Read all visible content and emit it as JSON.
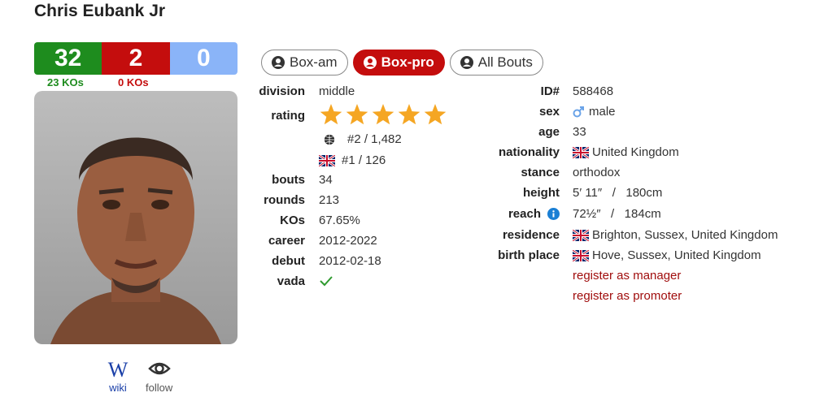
{
  "fighter": {
    "name": "Chris Eubank Jr"
  },
  "record": {
    "wins": "32",
    "losses": "2",
    "draws": "0",
    "win_kos": "23 KOs",
    "loss_kos": "0 KOs"
  },
  "links": {
    "wiki": "wiki",
    "follow": "follow"
  },
  "tabs": [
    {
      "label": "Box-am"
    },
    {
      "label": "Box-pro"
    },
    {
      "label": "All Bouts"
    }
  ],
  "left_stats": {
    "division": {
      "label": "division",
      "value": "middle"
    },
    "rating": {
      "label": "rating",
      "stars": 5,
      "world": "#2 / 1,482",
      "country": "#1 / 126"
    },
    "bouts": {
      "label": "bouts",
      "value": "34"
    },
    "rounds": {
      "label": "rounds",
      "value": "213"
    },
    "kos": {
      "label": "KOs",
      "value": "67.65%"
    },
    "career": {
      "label": "career",
      "value": "2012-2022"
    },
    "debut": {
      "label": "debut",
      "value": "2012-02-18"
    },
    "vada": {
      "label": "vada"
    }
  },
  "right_stats": {
    "id": {
      "label": "ID#",
      "value": "588468"
    },
    "sex": {
      "label": "sex",
      "value": "male"
    },
    "age": {
      "label": "age",
      "value": "33"
    },
    "nationality": {
      "label": "nationality",
      "value": "United Kingdom"
    },
    "stance": {
      "label": "stance",
      "value": "orthodox"
    },
    "height": {
      "label": "height",
      "value": "5′ 11″   /   180cm"
    },
    "reach": {
      "label": "reach",
      "value": "72½″   /   184cm"
    },
    "residence": {
      "label": "residence",
      "value": "Brighton, Sussex, United Kingdom"
    },
    "birthplace": {
      "label": "birth place",
      "value": "Hove, Sussex, United Kingdom"
    },
    "register_manager": "register as manager",
    "register_promoter": "register as promoter"
  },
  "colors": {
    "win": "#1e8c1e",
    "loss": "#c40d0d",
    "draw": "#8ab4f8",
    "star": "#f5a623",
    "link_red": "#a00d0d"
  }
}
